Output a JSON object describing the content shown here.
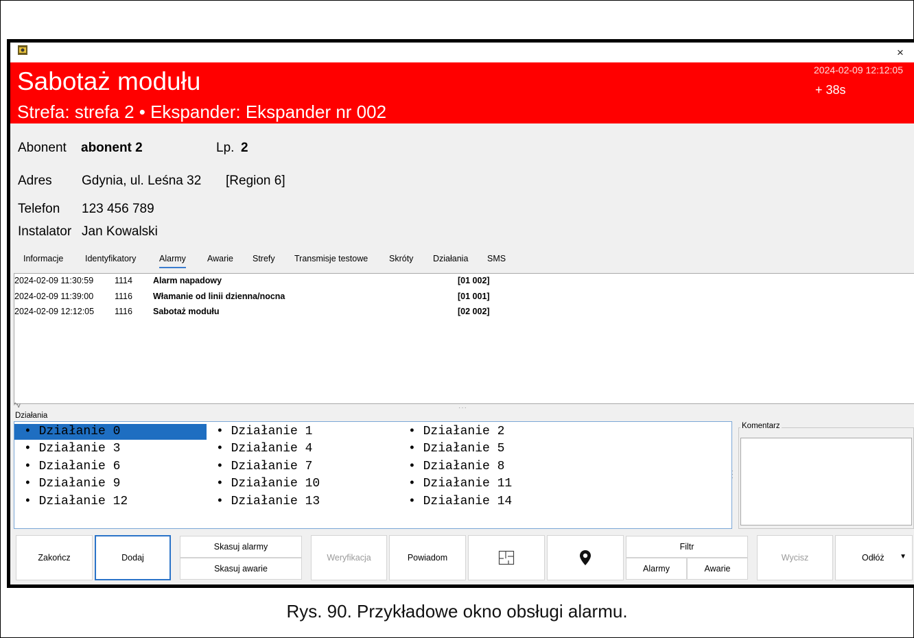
{
  "window": {
    "close_glyph": "×"
  },
  "header": {
    "title": "Sabotaż modułu",
    "subtitle": "Strefa: strefa 2 • Ekspander: Ekspander nr 002",
    "time": "2024-02-09 12:12:05",
    "elapsed": "+ 38s",
    "background_color": "#ff0000"
  },
  "info": {
    "abonent_label": "Abonent",
    "abonent_value": "abonent 2",
    "lp_label": "Lp.",
    "lp_value": "2",
    "adres_label": "Adres",
    "adres_value": "Gdynia, ul. Leśna 32",
    "region": "[Region 6]",
    "telefon_label": "Telefon",
    "telefon_value": "123 456 789",
    "instalator_label": "Instalator",
    "instalator_value": "Jan Kowalski"
  },
  "tabs": [
    {
      "label": "Informacje"
    },
    {
      "label": "Identyfikatory"
    },
    {
      "label": "Alarmy",
      "active": true
    },
    {
      "label": "Awarie"
    },
    {
      "label": "Strefy"
    },
    {
      "label": "Transmisje testowe"
    },
    {
      "label": "Skróty"
    },
    {
      "label": "Działania"
    },
    {
      "label": "SMS"
    }
  ],
  "alarms": [
    {
      "date": "2024-02-09 11:30:59",
      "code": "1114",
      "desc": "Alarm napadowy",
      "zone": "[01 002]"
    },
    {
      "date": "2024-02-09 11:39:00",
      "code": "1116",
      "desc": "Włamanie od linii dzienna/nocna",
      "zone": "[01 001]"
    },
    {
      "date": "2024-02-09 12:12:05",
      "code": "1116",
      "desc": "Sabotaż modułu",
      "zone": "[02 002]"
    }
  ],
  "actions": {
    "label": "Działania",
    "items": [
      "• Działanie 0",
      "• Działanie 1",
      "• Działanie 2",
      "• Działanie 3",
      "• Działanie 4",
      "• Działanie 5",
      "• Działanie 6",
      "• Działanie 7",
      "• Działanie 8",
      "• Działanie 9",
      "• Działanie 10",
      "• Działanie 11",
      "• Działanie 12",
      "• Działanie 13",
      "• Działanie 14"
    ],
    "selected_index": 0
  },
  "comment": {
    "label": "Komentarz",
    "value": ""
  },
  "buttons": {
    "zakoncz": "Zakończ",
    "dodaj": "Dodaj",
    "skasuj_alarmy": "Skasuj alarmy",
    "skasuj_awarie": "Skasuj awarie",
    "weryfikacja": "Weryfikacja",
    "powiadom": "Powiadom",
    "filtr": "Filtr",
    "filtr_alarmy": "Alarmy",
    "filtr_awarie": "Awarie",
    "wycisz": "Wycisz",
    "odloz": "Odłóż",
    "floorplan_icon": "floorplan-icon",
    "location_icon": "map-pin-icon"
  },
  "caption": "Rys. 90. Przykładowe okno obsługi alarmu."
}
